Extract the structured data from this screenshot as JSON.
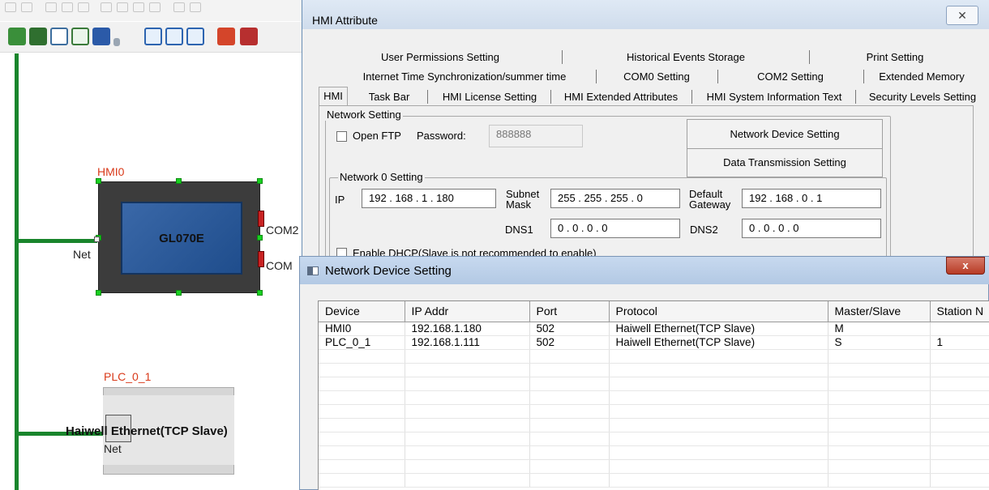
{
  "diagram": {
    "hmi": {
      "label": "HMI0",
      "model": "GL070E",
      "port_com2": "COM2",
      "port_com": "COM",
      "port_net": "Net"
    },
    "plc": {
      "label": "PLC_0_1",
      "protocol": "Haiwell Ethernet(TCP Slave)",
      "port_net": "Net"
    }
  },
  "hmi_attribute": {
    "title": "HMI Attribute",
    "close_glyph": "✕",
    "tabs_row1": [
      "User Permissions Setting",
      "Historical Events Storage",
      "Print Setting"
    ],
    "tabs_row2": [
      "Internet Time Synchronization/summer time",
      "COM0 Setting",
      "COM2 Setting",
      "Extended Memory"
    ],
    "tabs_row3": [
      "HMI",
      "Task Bar",
      "HMI License Setting",
      "HMI Extended Attributes",
      "HMI System Information Text",
      "Security Levels Setting"
    ],
    "network_setting": {
      "legend": "Network Setting",
      "open_ftp_label": "Open FTP",
      "password_label": "Password:",
      "password_value": "888888",
      "network_device_button": "Network Device Setting",
      "data_transmission_button": "Data Transmission Setting"
    },
    "network0": {
      "legend": "Network 0 Setting",
      "ip_label": "IP",
      "ip_value": "192 . 168 . 1 . 180",
      "subnet_label_1": "Subnet",
      "subnet_label_2": "Mask",
      "subnet_value": "255 . 255 . 255 . 0",
      "gateway_label_1": "Default",
      "gateway_label_2": "Gateway",
      "gateway_value": "192 . 168 . 0 . 1",
      "dns1_label": "DNS1",
      "dns1_value": "0 . 0 . 0 . 0",
      "dns2_label": "DNS2",
      "dns2_value": "0 . 0 . 0 . 0",
      "dhcp_label": "Enable DHCP(Slave is not recommended to enable)"
    }
  },
  "network_device_setting": {
    "title": "Network Device Setting",
    "close_glyph": "x",
    "columns": [
      "Device",
      "IP Addr",
      "Port",
      "Protocol",
      "Master/Slave",
      "Station N"
    ],
    "rows": [
      [
        "HMI0",
        "192.168.1.180",
        "502",
        "Haiwell Ethernet(TCP Slave)",
        "M",
        ""
      ],
      [
        "PLC_0_1",
        "192.168.1.111",
        "502",
        "Haiwell Ethernet(TCP Slave)",
        "S",
        "1"
      ]
    ]
  }
}
